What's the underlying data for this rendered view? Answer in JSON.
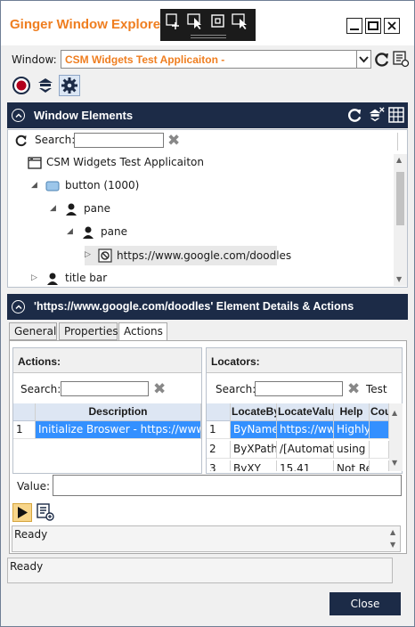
{
  "app": {
    "title": "Ginger Window Explorer"
  },
  "window_bar": {
    "label": "Window:",
    "selected": "CSM Widgets Test Applicaiton -"
  },
  "elements_panel": {
    "title": "Window Elements",
    "search_label": "Search:",
    "search_value": "",
    "tree": [
      {
        "label": "CSM Widgets Test Applicaiton",
        "icon": "window-icon",
        "caret": ""
      },
      {
        "label": "button (1000)",
        "icon": "button-icon",
        "caret": "◢"
      },
      {
        "label": "pane",
        "icon": "user-icon",
        "caret": "◢"
      },
      {
        "label": "pane",
        "icon": "user-icon",
        "caret": "◢"
      },
      {
        "label": "https://www.google.com/doodles",
        "icon": "link-element-icon",
        "caret": "▷"
      },
      {
        "label": "title bar",
        "icon": "user-icon",
        "caret": "▷"
      }
    ]
  },
  "details_panel": {
    "title": "'https://www.google.com/doodles' Element Details & Actions",
    "tabs": [
      "General",
      "Properties",
      "Actions"
    ],
    "active_tab": "Actions",
    "actions": {
      "header": "Actions:",
      "search_label": "Search:",
      "columns": [
        "Description"
      ],
      "rows": [
        {
          "num": "1",
          "description": "Initialize Broswer - https://www.gc"
        }
      ]
    },
    "locators": {
      "header": "Locators:",
      "search_label": "Search:",
      "test_label": "Test",
      "columns": [
        "LocateBy",
        "LocateValu",
        "Help",
        "Cou"
      ],
      "rows": [
        {
          "num": "1",
          "by": "ByName",
          "value": "https://ww",
          "help": "Highly"
        },
        {
          "num": "2",
          "by": "ByXPath",
          "value": "/[Automati",
          "help": "using /"
        },
        {
          "num": "3",
          "by": "ByXY",
          "value": "15,41",
          "help": "Not Re"
        }
      ]
    },
    "value_label": "Value:",
    "value": "",
    "status_inner": "Ready"
  },
  "status_outer": "Ready",
  "close_label": "Close",
  "colors": {
    "accent": "#ef7e20",
    "header": "#1c2b47",
    "selection": "#3390ff"
  }
}
